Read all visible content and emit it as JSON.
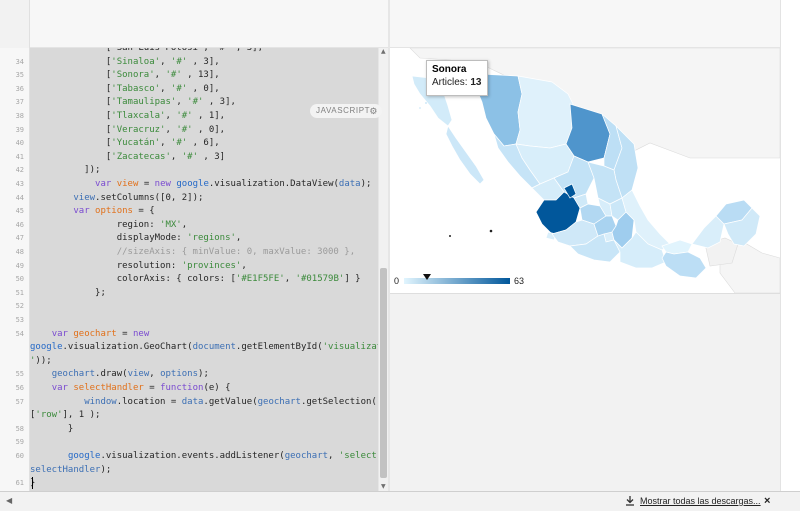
{
  "editor": {
    "language_badge": "JAVASCRIPT",
    "settings_icon": "gear-icon",
    "lines": [
      {
        "num": "",
        "tokens": [
          {
            "t": "pl",
            "v": "              ['San Luis Potosí', '#' , 3],"
          }
        ]
      },
      {
        "num": "34",
        "tokens": [
          {
            "t": "pl",
            "v": "              ["
          },
          {
            "t": "str",
            "v": "'Sinaloa'"
          },
          {
            "t": "pl",
            "v": ", "
          },
          {
            "t": "str",
            "v": "'#'"
          },
          {
            "t": "pl",
            "v": " , 3],"
          }
        ]
      },
      {
        "num": "35",
        "tokens": [
          {
            "t": "pl",
            "v": "              ["
          },
          {
            "t": "str",
            "v": "'Sonora'"
          },
          {
            "t": "pl",
            "v": ", "
          },
          {
            "t": "str",
            "v": "'#'"
          },
          {
            "t": "pl",
            "v": " , 13],"
          }
        ]
      },
      {
        "num": "36",
        "tokens": [
          {
            "t": "pl",
            "v": "              ["
          },
          {
            "t": "str",
            "v": "'Tabasco'"
          },
          {
            "t": "pl",
            "v": ", "
          },
          {
            "t": "str",
            "v": "'#'"
          },
          {
            "t": "pl",
            "v": " , 0],"
          }
        ]
      },
      {
        "num": "37",
        "tokens": [
          {
            "t": "pl",
            "v": "              ["
          },
          {
            "t": "str",
            "v": "'Tamaulipas'"
          },
          {
            "t": "pl",
            "v": ", "
          },
          {
            "t": "str",
            "v": "'#'"
          },
          {
            "t": "pl",
            "v": " , 3],"
          }
        ]
      },
      {
        "num": "38",
        "tokens": [
          {
            "t": "pl",
            "v": "              ["
          },
          {
            "t": "str",
            "v": "'Tlaxcala'"
          },
          {
            "t": "pl",
            "v": ", "
          },
          {
            "t": "str",
            "v": "'#'"
          },
          {
            "t": "pl",
            "v": " , 1],"
          }
        ]
      },
      {
        "num": "39",
        "tokens": [
          {
            "t": "pl",
            "v": "              ["
          },
          {
            "t": "str",
            "v": "'Veracruz'"
          },
          {
            "t": "pl",
            "v": ", "
          },
          {
            "t": "str",
            "v": "'#'"
          },
          {
            "t": "pl",
            "v": " , 0],"
          }
        ]
      },
      {
        "num": "40",
        "tokens": [
          {
            "t": "pl",
            "v": "              ["
          },
          {
            "t": "str",
            "v": "'Yucatán'"
          },
          {
            "t": "pl",
            "v": ", "
          },
          {
            "t": "str",
            "v": "'#'"
          },
          {
            "t": "pl",
            "v": " , 6],"
          }
        ]
      },
      {
        "num": "41",
        "tokens": [
          {
            "t": "pl",
            "v": "              ["
          },
          {
            "t": "str",
            "v": "'Zacatecas'"
          },
          {
            "t": "pl",
            "v": ", "
          },
          {
            "t": "str",
            "v": "'#'"
          },
          {
            "t": "pl",
            "v": " , 3]"
          }
        ]
      },
      {
        "num": "42",
        "tokens": [
          {
            "t": "pl",
            "v": "          ]);"
          }
        ]
      },
      {
        "num": "43",
        "tokens": [
          {
            "t": "pl",
            "v": "            "
          },
          {
            "t": "kw",
            "v": "var"
          },
          {
            "t": "pl",
            "v": " "
          },
          {
            "t": "var",
            "v": "view"
          },
          {
            "t": "pl",
            "v": " = "
          },
          {
            "t": "kw",
            "v": "new"
          },
          {
            "t": "pl",
            "v": " "
          },
          {
            "t": "fn",
            "v": "google"
          },
          {
            "t": "pl",
            "v": ".visualization.DataView("
          },
          {
            "t": "id",
            "v": "data"
          },
          {
            "t": "pl",
            "v": ");"
          }
        ]
      },
      {
        "num": "44",
        "tokens": [
          {
            "t": "pl",
            "v": "        "
          },
          {
            "t": "id",
            "v": "view"
          },
          {
            "t": "pl",
            "v": ".setColumns([0, 2]);"
          }
        ]
      },
      {
        "num": "45",
        "tokens": [
          {
            "t": "pl",
            "v": "        "
          },
          {
            "t": "kw",
            "v": "var"
          },
          {
            "t": "pl",
            "v": " "
          },
          {
            "t": "var",
            "v": "options"
          },
          {
            "t": "pl",
            "v": " = {"
          }
        ]
      },
      {
        "num": "46",
        "tokens": [
          {
            "t": "pl",
            "v": "                region: "
          },
          {
            "t": "str",
            "v": "'MX'"
          },
          {
            "t": "pl",
            "v": ","
          }
        ]
      },
      {
        "num": "47",
        "tokens": [
          {
            "t": "pl",
            "v": "                displayMode: "
          },
          {
            "t": "str",
            "v": "'regions'"
          },
          {
            "t": "pl",
            "v": ","
          }
        ]
      },
      {
        "num": "48",
        "tokens": [
          {
            "t": "cm",
            "v": "                //sizeAxis: { minValue: 0, maxValue: 3000 },"
          }
        ]
      },
      {
        "num": "49",
        "tokens": [
          {
            "t": "pl",
            "v": "                resolution: "
          },
          {
            "t": "str",
            "v": "'provinces'"
          },
          {
            "t": "pl",
            "v": ","
          }
        ]
      },
      {
        "num": "50",
        "tokens": [
          {
            "t": "pl",
            "v": "                colorAxis: { colors: ["
          },
          {
            "t": "str",
            "v": "'#E1F5FE'"
          },
          {
            "t": "pl",
            "v": ", "
          },
          {
            "t": "str",
            "v": "'#01579B'"
          },
          {
            "t": "pl",
            "v": "] }"
          }
        ]
      },
      {
        "num": "51",
        "tokens": [
          {
            "t": "pl",
            "v": "            };"
          }
        ]
      },
      {
        "num": "52",
        "tokens": []
      },
      {
        "num": "53",
        "tokens": []
      },
      {
        "num": "54",
        "tokens": [
          {
            "t": "pl",
            "v": "    "
          },
          {
            "t": "kw",
            "v": "var"
          },
          {
            "t": "pl",
            "v": " "
          },
          {
            "t": "var",
            "v": "geochart"
          },
          {
            "t": "pl",
            "v": " = "
          },
          {
            "t": "kw",
            "v": "new"
          }
        ]
      },
      {
        "num": "",
        "tokens": [
          {
            "t": "fn",
            "v": "google"
          },
          {
            "t": "pl",
            "v": ".visualization.GeoChart("
          },
          {
            "t": "id",
            "v": "document"
          },
          {
            "t": "pl",
            "v": ".getElementById("
          },
          {
            "t": "str",
            "v": "'visualization"
          }
        ]
      },
      {
        "num": "",
        "tokens": [
          {
            "t": "str",
            "v": "'"
          },
          {
            "t": "pl",
            "v": "));"
          }
        ]
      },
      {
        "num": "55",
        "tokens": [
          {
            "t": "pl",
            "v": "    "
          },
          {
            "t": "id",
            "v": "geochart"
          },
          {
            "t": "pl",
            "v": ".draw("
          },
          {
            "t": "id",
            "v": "view"
          },
          {
            "t": "pl",
            "v": ", "
          },
          {
            "t": "id",
            "v": "options"
          },
          {
            "t": "pl",
            "v": ");"
          }
        ]
      },
      {
        "num": "56",
        "tokens": [
          {
            "t": "pl",
            "v": "    "
          },
          {
            "t": "kw",
            "v": "var"
          },
          {
            "t": "pl",
            "v": " "
          },
          {
            "t": "var",
            "v": "selectHandler"
          },
          {
            "t": "pl",
            "v": " = "
          },
          {
            "t": "kw",
            "v": "function"
          },
          {
            "t": "pl",
            "v": "(e) {"
          }
        ]
      },
      {
        "num": "57",
        "tokens": [
          {
            "t": "pl",
            "v": "          "
          },
          {
            "t": "id",
            "v": "window"
          },
          {
            "t": "pl",
            "v": ".location = "
          },
          {
            "t": "id",
            "v": "data"
          },
          {
            "t": "pl",
            "v": ".getValue("
          },
          {
            "t": "id",
            "v": "geochart"
          },
          {
            "t": "pl",
            "v": ".getSelection()[0]"
          }
        ]
      },
      {
        "num": "",
        "tokens": [
          {
            "t": "pl",
            "v": "["
          },
          {
            "t": "str",
            "v": "'row'"
          },
          {
            "t": "pl",
            "v": "], 1 );"
          }
        ]
      },
      {
        "num": "58",
        "tokens": [
          {
            "t": "pl",
            "v": "       }"
          }
        ]
      },
      {
        "num": "59",
        "tokens": []
      },
      {
        "num": "60",
        "tokens": [
          {
            "t": "pl",
            "v": "       "
          },
          {
            "t": "fn",
            "v": "google"
          },
          {
            "t": "pl",
            "v": ".visualization.events.addListener("
          },
          {
            "t": "id",
            "v": "geochart"
          },
          {
            "t": "pl",
            "v": ", "
          },
          {
            "t": "str",
            "v": "'select'"
          },
          {
            "t": "pl",
            "v": ","
          }
        ]
      },
      {
        "num": "",
        "tokens": [
          {
            "t": "id",
            "v": "selectHandler"
          },
          {
            "t": "pl",
            "v": ");"
          }
        ]
      },
      {
        "num": "61",
        "tokens": [
          {
            "t": "pl",
            "v": "}"
          }
        ]
      }
    ]
  },
  "map": {
    "tooltip": {
      "title": "Sonora",
      "metric_label": "Articles:",
      "metric_value": "13"
    },
    "legend": {
      "min": "0",
      "max": "63",
      "marker_value": 3,
      "colors": [
        "#E1F5FE",
        "#01579B"
      ]
    }
  },
  "downloads": {
    "link_label": "Mostrar todas las descargas...",
    "close_label": "×",
    "icon": "download-icon"
  }
}
